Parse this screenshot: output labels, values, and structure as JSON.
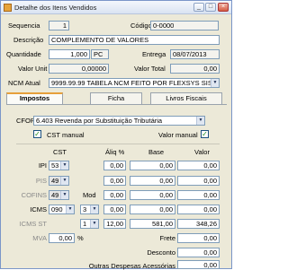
{
  "window": {
    "title": "Detalhe dos Itens Vendidos",
    "buttons": {
      "minimize": "_",
      "maximize": "□",
      "close": "×"
    }
  },
  "header": {
    "sequencia_label": "Sequencia",
    "sequencia_value": "1",
    "codigo_label": "Código",
    "codigo_value": "0-0000",
    "descricao_label": "Descrição",
    "descricao_value": "COMPLEMENTO DE VALORES",
    "quantidade_label": "Quantidade",
    "quantidade_value": "1,000",
    "unidade_value": "PC",
    "entrega_label": "Entrega",
    "entrega_value": "08/07/2013",
    "valor_unit_label": "Valor Unit",
    "valor_unit_value": "0,00000",
    "valor_total_label": "Valor Total",
    "valor_total_value": "0,00",
    "ncm_label": "NCM Atual",
    "ncm_value": "9999.99.99   TABELA NCM FEITO POR FLEXSYS SIS"
  },
  "tabs": [
    {
      "label": "Impostos"
    },
    {
      "label": "Ficha"
    },
    {
      "label": "Livros Fiscais"
    }
  ],
  "impostos": {
    "cfop_label": "CFOP",
    "cfop_value": "6.403   Revenda por Substituição Tributária",
    "cst_manual_label": "CST manual",
    "cst_manual_checked": "✓",
    "valor_manual_label": "Valor manual",
    "valor_manual_checked": "✓",
    "headers": {
      "cst": "CST",
      "aliq": "Áliq %",
      "base": "Base",
      "valor": "Valor"
    },
    "rows": [
      {
        "label": "IPI",
        "cst": "53",
        "aliq": "0,00",
        "base": "0,00",
        "valor": "0,00"
      },
      {
        "label": "PIS",
        "cst": "49",
        "aliq": "0,00",
        "base": "0,00",
        "valor": "0,00"
      },
      {
        "label": "COFINS",
        "cst": "49",
        "mod_label": "Mod",
        "aliq": "0,00",
        "base": "0,00",
        "valor": "0,00"
      },
      {
        "label": "ICMS",
        "cst": "090",
        "mod": "3",
        "aliq": "0,00",
        "base": "0,00",
        "valor": "0,00"
      },
      {
        "label": "ICMS ST",
        "mod": "1",
        "aliq": "12,00",
        "base": "581,00",
        "valor": "348,26"
      }
    ],
    "mva_label": "MVA",
    "mva_value": "0,00",
    "mva_unit": "%",
    "frete_label": "Frete",
    "frete_value": "0,00",
    "desconto_label": "Desconto",
    "desconto_value": "0,00",
    "outras_label": "Outras Despesas Acessórias",
    "outras_value": "0,00"
  }
}
